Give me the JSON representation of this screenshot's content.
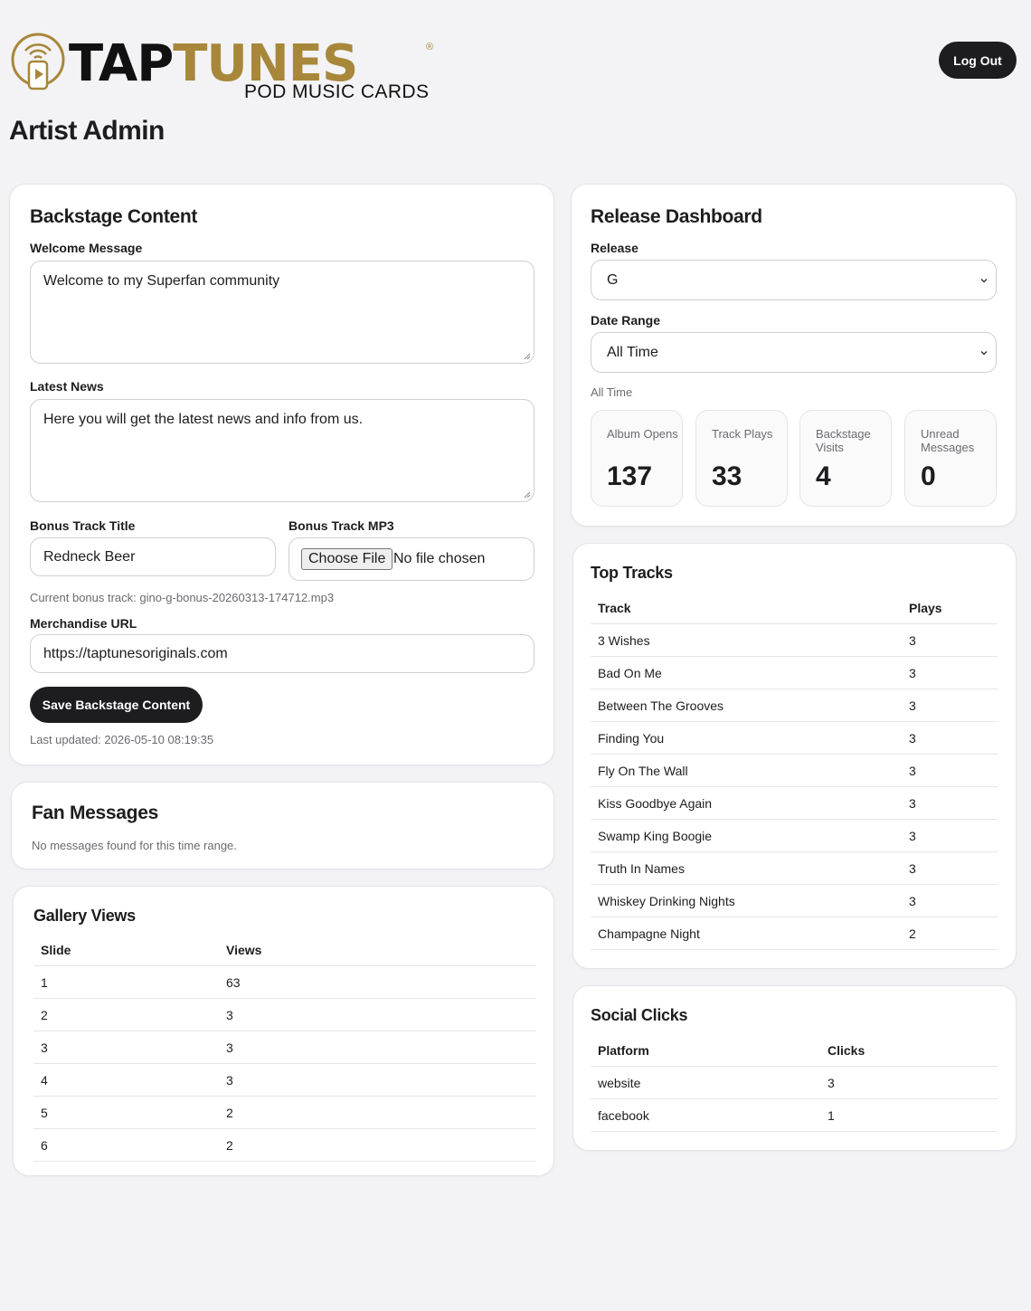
{
  "brand": {
    "name_part1": "TAP",
    "name_part2": "TUNES",
    "registered": "®",
    "tagline": "POD MUSIC CARDS",
    "gold": "#a8873a"
  },
  "header": {
    "logout_label": "Log Out",
    "page_title": "Artist Admin"
  },
  "backstage": {
    "title": "Backstage Content",
    "welcome_label": "Welcome Message",
    "welcome_value": "Welcome to my Superfan community",
    "news_label": "Latest News",
    "news_value": "Here you will get the latest news and info from us.",
    "bonus_title_label": "Bonus Track Title",
    "bonus_title_value": "Redneck Beer",
    "bonus_mp3_label": "Bonus Track MP3",
    "file_button": "Choose File",
    "file_status": "No file chosen",
    "current_bonus": "Current bonus track: gino-g-bonus-20260313-174712.mp3",
    "merch_label": "Merchandise URL",
    "merch_value": "https://taptunesoriginals.com",
    "save_label": "Save Backstage Content",
    "last_updated": "Last updated: 2026-05-10 08:19:35"
  },
  "fan_messages": {
    "title": "Fan Messages",
    "empty": "No messages found for this time range."
  },
  "gallery": {
    "title": "Gallery Views",
    "col_slide": "Slide",
    "col_views": "Views",
    "rows": [
      {
        "slide": "1",
        "views": "63"
      },
      {
        "slide": "2",
        "views": "3"
      },
      {
        "slide": "3",
        "views": "3"
      },
      {
        "slide": "4",
        "views": "3"
      },
      {
        "slide": "5",
        "views": "2"
      },
      {
        "slide": "6",
        "views": "2"
      }
    ]
  },
  "release_dashboard": {
    "title": "Release Dashboard",
    "release_label": "Release",
    "release_value": "G",
    "date_label": "Date Range",
    "date_value": "All Time",
    "range_caption": "All Time",
    "stats": [
      {
        "label": "Album Opens",
        "value": "137"
      },
      {
        "label": "Track Plays",
        "value": "33"
      },
      {
        "label": "Backstage Visits",
        "value": "4"
      },
      {
        "label": "Unread Messages",
        "value": "0"
      }
    ]
  },
  "top_tracks": {
    "title": "Top Tracks",
    "col_track": "Track",
    "col_plays": "Plays",
    "rows": [
      {
        "track": "3 Wishes",
        "plays": "3"
      },
      {
        "track": "Bad On Me",
        "plays": "3"
      },
      {
        "track": "Between The Grooves",
        "plays": "3"
      },
      {
        "track": "Finding You",
        "plays": "3"
      },
      {
        "track": "Fly On The Wall",
        "plays": "3"
      },
      {
        "track": "Kiss Goodbye Again",
        "plays": "3"
      },
      {
        "track": "Swamp King Boogie",
        "plays": "3"
      },
      {
        "track": "Truth In Names",
        "plays": "3"
      },
      {
        "track": "Whiskey Drinking Nights",
        "plays": "3"
      },
      {
        "track": "Champagne Night",
        "plays": "2"
      }
    ]
  },
  "social_clicks": {
    "title": "Social Clicks",
    "col_platform": "Platform",
    "col_clicks": "Clicks",
    "rows": [
      {
        "platform": "website",
        "clicks": "3"
      },
      {
        "platform": "facebook",
        "clicks": "1"
      }
    ]
  }
}
